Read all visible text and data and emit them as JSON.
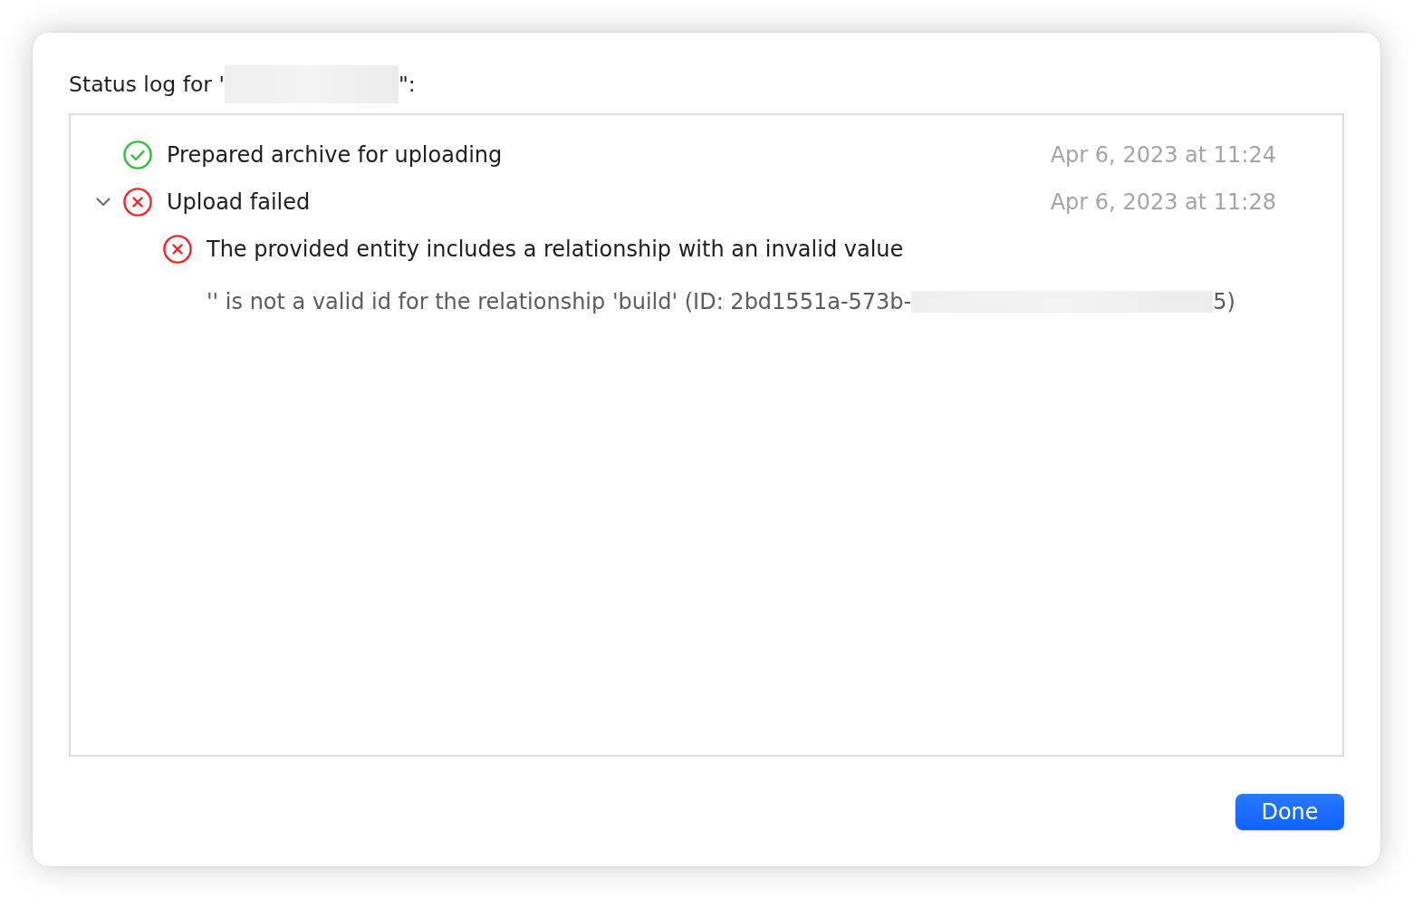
{
  "dialog": {
    "title": {
      "before": "Status log for '",
      "after": "\":"
    }
  },
  "log": {
    "entries": [
      {
        "kind": "success",
        "message": "Prepared archive for uploading",
        "timestamp": "Apr 6, 2023 at 11:24"
      },
      {
        "kind": "error",
        "message": "Upload failed",
        "timestamp": "Apr 6, 2023 at 11:28",
        "expanded": true,
        "children": [
          {
            "kind": "error",
            "message": "The provided entity includes a relationship with an invalid value",
            "detail": {
              "before": "'' is not a valid id for the relationship 'build' (ID: 2bd1551a-573b-",
              "after": "5)"
            }
          }
        ]
      }
    ]
  },
  "footer": {
    "done_button": {
      "label": "Done"
    }
  }
}
